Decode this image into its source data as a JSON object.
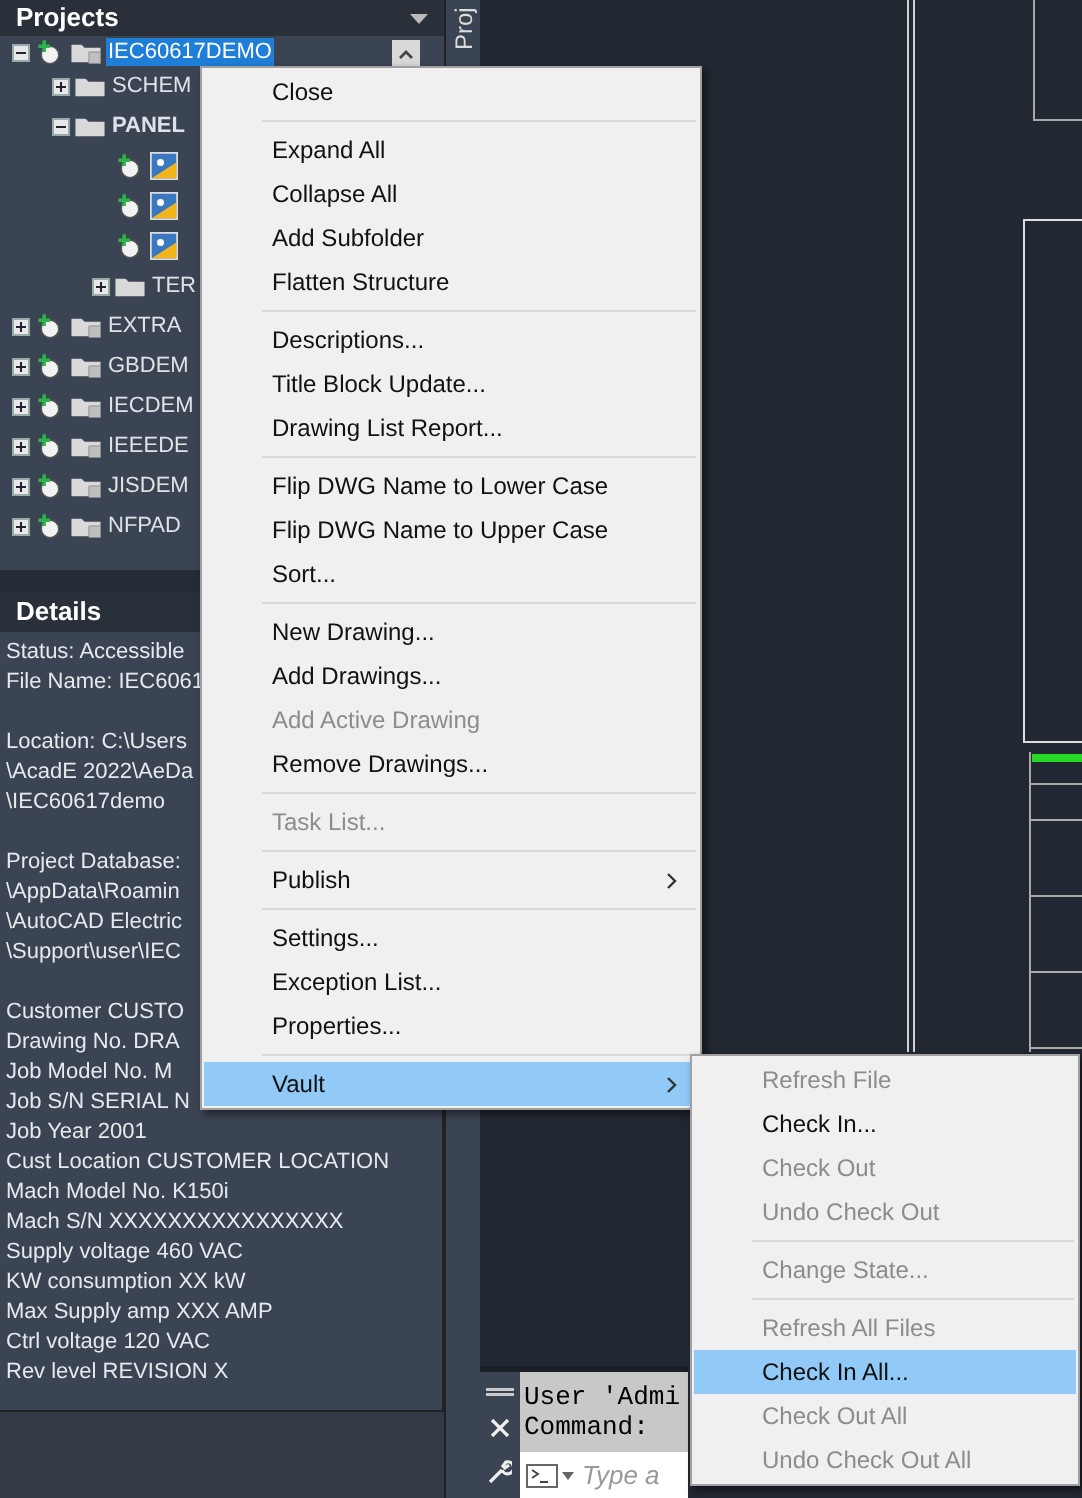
{
  "projects_panel": {
    "title": "Projects",
    "side_tab": "Proj",
    "tree": [
      {
        "kind": "project",
        "label": "IEC60617DEMO",
        "selected": true,
        "expanded": true,
        "children": [
          {
            "kind": "folder",
            "label": "SCHEM",
            "selected": false,
            "expanded": false
          },
          {
            "kind": "folder",
            "label": "PANEL",
            "selected": false,
            "expanded": true,
            "bold": true,
            "children": [
              {
                "kind": "drawing"
              },
              {
                "kind": "drawing"
              },
              {
                "kind": "drawing"
              },
              {
                "kind": "folder",
                "label": "TER",
                "selected": false,
                "expanded": false
              }
            ]
          }
        ]
      },
      {
        "kind": "project",
        "label": "EXTRA",
        "selected": false,
        "expanded": false
      },
      {
        "kind": "project",
        "label": "GBDEM",
        "selected": false,
        "expanded": false
      },
      {
        "kind": "project",
        "label": "IECDEM",
        "selected": false,
        "expanded": false
      },
      {
        "kind": "project",
        "label": "IEEEDE",
        "selected": false,
        "expanded": false
      },
      {
        "kind": "project",
        "label": "JISDEM",
        "selected": false,
        "expanded": false
      },
      {
        "kind": "project",
        "label": "NFPAD",
        "selected": false,
        "expanded": false
      }
    ]
  },
  "details": {
    "title": "Details",
    "groups": [
      [
        "Status: Accessible",
        "File Name: IEC6061"
      ],
      [
        "Location: C:\\Users",
        "\\AcadE 2022\\AeDa",
        "\\IEC60617demo"
      ],
      [
        "Project Database:",
        "\\AppData\\Roamin",
        "\\AutoCAD Electric",
        "\\Support\\user\\IEC"
      ],
      [
        "Customer CUSTO",
        "Drawing No. DRA",
        "Job Model No. M",
        "Job S/N SERIAL N",
        "Job Year 2001",
        "Cust Location CUSTOMER LOCATION",
        "Mach Model No. K150i",
        "Mach S/N XXXXXXXXXXXXXXXX",
        "Supply voltage 460 VAC",
        "KW consumption XX kW",
        "Max Supply amp XXX AMP",
        "Ctrl voltage 120 VAC",
        "Rev level REVISION X"
      ]
    ]
  },
  "context_menu": [
    {
      "kind": "item",
      "label": "Close",
      "disabled": false,
      "selected": false
    },
    {
      "kind": "separator"
    },
    {
      "kind": "item",
      "label": "Expand All",
      "disabled": false,
      "selected": false
    },
    {
      "kind": "item",
      "label": "Collapse All",
      "disabled": false,
      "selected": false
    },
    {
      "kind": "item",
      "label": "Add Subfolder",
      "disabled": false,
      "selected": false
    },
    {
      "kind": "item",
      "label": "Flatten Structure",
      "disabled": false,
      "selected": false
    },
    {
      "kind": "separator"
    },
    {
      "kind": "item",
      "label": "Descriptions...",
      "disabled": false,
      "selected": false
    },
    {
      "kind": "item",
      "label": "Title Block Update...",
      "disabled": false,
      "selected": false
    },
    {
      "kind": "item",
      "label": "Drawing List Report...",
      "disabled": false,
      "selected": false
    },
    {
      "kind": "separator"
    },
    {
      "kind": "item",
      "label": "Flip DWG Name to Lower Case",
      "disabled": false,
      "selected": false
    },
    {
      "kind": "item",
      "label": "Flip DWG Name to Upper Case",
      "disabled": false,
      "selected": false
    },
    {
      "kind": "item",
      "label": "Sort...",
      "disabled": false,
      "selected": false
    },
    {
      "kind": "separator"
    },
    {
      "kind": "item",
      "label": "New Drawing...",
      "disabled": false,
      "selected": false
    },
    {
      "kind": "item",
      "label": "Add Drawings...",
      "disabled": false,
      "selected": false
    },
    {
      "kind": "item",
      "label": "Add Active Drawing",
      "disabled": true,
      "selected": false
    },
    {
      "kind": "item",
      "label": "Remove Drawings...",
      "disabled": false,
      "selected": false
    },
    {
      "kind": "separator"
    },
    {
      "kind": "item",
      "label": "Task List...",
      "disabled": true,
      "selected": false
    },
    {
      "kind": "separator"
    },
    {
      "kind": "submenu",
      "label": "Publish",
      "disabled": false,
      "selected": false
    },
    {
      "kind": "separator"
    },
    {
      "kind": "item",
      "label": "Settings...",
      "disabled": false,
      "selected": false
    },
    {
      "kind": "item",
      "label": "Exception List...",
      "disabled": false,
      "selected": false
    },
    {
      "kind": "item",
      "label": "Properties...",
      "disabled": false,
      "selected": false
    },
    {
      "kind": "separator"
    },
    {
      "kind": "submenu",
      "label": "Vault",
      "disabled": false,
      "selected": true
    }
  ],
  "vault_submenu": [
    {
      "kind": "item",
      "label": "Refresh File",
      "disabled": true,
      "selected": false
    },
    {
      "kind": "item",
      "label": "Check In...",
      "disabled": false,
      "selected": false
    },
    {
      "kind": "item",
      "label": "Check Out",
      "disabled": true,
      "selected": false
    },
    {
      "kind": "item",
      "label": "Undo Check Out",
      "disabled": true,
      "selected": false
    },
    {
      "kind": "separator"
    },
    {
      "kind": "item",
      "label": "Change State...",
      "disabled": true,
      "selected": false
    },
    {
      "kind": "separator"
    },
    {
      "kind": "item",
      "label": "Refresh All Files",
      "disabled": true,
      "selected": false
    },
    {
      "kind": "item",
      "label": "Check In All...",
      "disabled": false,
      "selected": true
    },
    {
      "kind": "item",
      "label": "Check Out All",
      "disabled": true,
      "selected": false
    },
    {
      "kind": "item",
      "label": "Undo Check Out All",
      "disabled": true,
      "selected": false
    }
  ],
  "command_line": {
    "history": [
      "User 'Admi",
      "Command:"
    ],
    "placeholder": "Type a"
  }
}
